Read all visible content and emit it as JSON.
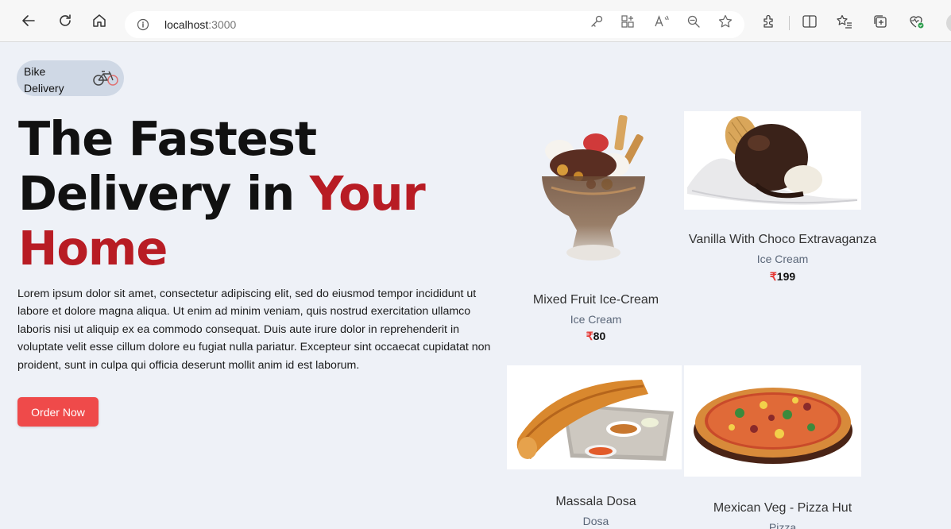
{
  "browser": {
    "url_host": "localhost",
    "url_port": ":3000"
  },
  "badge": {
    "text": "Bike Delivery",
    "icon": "bicycle-icon"
  },
  "hero": {
    "title_line1": "The Fastest",
    "title_line2_plain": "Delivery in ",
    "title_line2_accent": "Your",
    "title_line3_accent": "Home",
    "description": "Lorem ipsum dolor sit amet, consectetur adipiscing elit, sed do eiusmod tempor incididunt ut labore et dolore magna aliqua. Ut enim ad minim veniam, quis nostrud exercitation ullamco laboris nisi ut aliquip ex ea commodo consequat. Duis aute irure dolor in reprehenderit in voluptate velit esse cillum dolore eu fugiat nulla pariatur. Excepteur sint occaecat cupidatat non proident, sunt in culpa qui officia deserunt mollit anim id est laborum.",
    "order_button": "Order Now",
    "accent_color": "#b81c24",
    "button_color": "#ef4a4a"
  },
  "currency_symbol": "₹",
  "products": [
    {
      "name": "Mixed Fruit Ice-Cream",
      "category": "Ice Cream",
      "price": "80"
    },
    {
      "name": "Vanilla With Choco Extravaganza",
      "category": "Ice Cream",
      "price": "199"
    },
    {
      "name": "Massala Dosa",
      "category": "Dosa"
    },
    {
      "name": "Mexican Veg - Pizza Hut",
      "category": "Pizza"
    }
  ]
}
